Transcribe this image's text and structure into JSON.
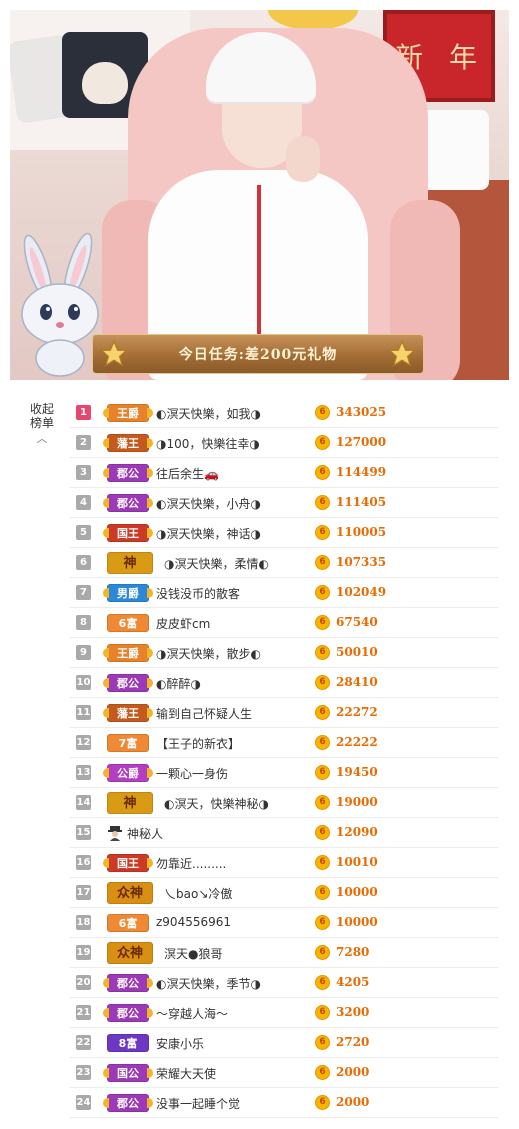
{
  "stream": {
    "task_banner": "今日任务:差200元礼物",
    "panel_chars": [
      "新",
      "年"
    ]
  },
  "collapse_label_line1": "收起",
  "collapse_label_line2": "榜单",
  "coin_glyph": "6",
  "ranking": [
    {
      "rank": "1",
      "badge": "王爵",
      "badge_type": "king-royal",
      "name": "◐溟天快樂，如我◑",
      "value": "343025"
    },
    {
      "rank": "2",
      "badge": "藩王",
      "badge_type": "king-fan",
      "name": "◑100，快樂往幸◑",
      "value": "127000"
    },
    {
      "rank": "3",
      "badge": "郡公",
      "badge_type": "duke",
      "name": "往后余生🚗",
      "value": "114499"
    },
    {
      "rank": "4",
      "badge": "郡公",
      "badge_type": "duke",
      "name": "◐溟天快樂，小舟◑",
      "value": "111405"
    },
    {
      "rank": "5",
      "badge": "国王",
      "badge_type": "guowang",
      "name": "◑溟天快樂，神话◑",
      "value": "110005"
    },
    {
      "rank": "6",
      "badge": "神",
      "badge_type": "shen",
      "name": "◑溟天快樂，柔情◐",
      "value": "107335"
    },
    {
      "rank": "7",
      "badge": "男爵",
      "badge_type": "nanjue",
      "name": "没钱没币的散客",
      "value": "102049"
    },
    {
      "rank": "8",
      "badge": "6富",
      "badge_type": "fu6",
      "name": "皮皮虾cm",
      "value": "67540"
    },
    {
      "rank": "9",
      "badge": "王爵",
      "badge_type": "king-royal",
      "name": "◑溟天快樂，散步◐",
      "value": "50010"
    },
    {
      "rank": "10",
      "badge": "郡公",
      "badge_type": "duke",
      "name": "◐醉醉◑",
      "value": "28410"
    },
    {
      "rank": "11",
      "badge": "藩王",
      "badge_type": "king-fan",
      "name": "输到自己怀疑人生",
      "value": "22272"
    },
    {
      "rank": "12",
      "badge": "7富",
      "badge_type": "fu7",
      "name": "【王子的新衣】",
      "value": "22222"
    },
    {
      "rank": "13",
      "badge": "公爵",
      "badge_type": "gongjue",
      "name": "一颗心一身伤",
      "value": "19450"
    },
    {
      "rank": "14",
      "badge": "神",
      "badge_type": "shen",
      "name": "◐溟天，快樂神秘◑",
      "value": "19000"
    },
    {
      "rank": "15",
      "badge": "",
      "badge_type": "mystery",
      "name": "神秘人",
      "value": "12090"
    },
    {
      "rank": "16",
      "badge": "国王",
      "badge_type": "guowang",
      "name": "勿靠近.........",
      "value": "10010"
    },
    {
      "rank": "17",
      "badge": "众神",
      "badge_type": "zhongshen",
      "name": "乀bao↘冷傲",
      "value": "10000"
    },
    {
      "rank": "18",
      "badge": "6富",
      "badge_type": "fu6",
      "name": "z904556961",
      "value": "10000"
    },
    {
      "rank": "19",
      "badge": "众神",
      "badge_type": "zhongshen",
      "name": "溟天●狼哥",
      "value": "7280"
    },
    {
      "rank": "20",
      "badge": "郡公",
      "badge_type": "duke",
      "name": "◐溟天快樂，季节◑",
      "value": "4205"
    },
    {
      "rank": "21",
      "badge": "郡公",
      "badge_type": "duke",
      "name": "～穿越人海～",
      "value": "3200"
    },
    {
      "rank": "22",
      "badge": "8富",
      "badge_type": "fu8",
      "name": "安康小乐",
      "value": "2720"
    },
    {
      "rank": "23",
      "badge": "国公",
      "badge_type": "duke",
      "name": "荣耀大天使",
      "value": "2000"
    },
    {
      "rank": "24",
      "badge": "郡公",
      "badge_type": "duke",
      "name": "没事一起睡个觉",
      "value": "2000"
    }
  ]
}
